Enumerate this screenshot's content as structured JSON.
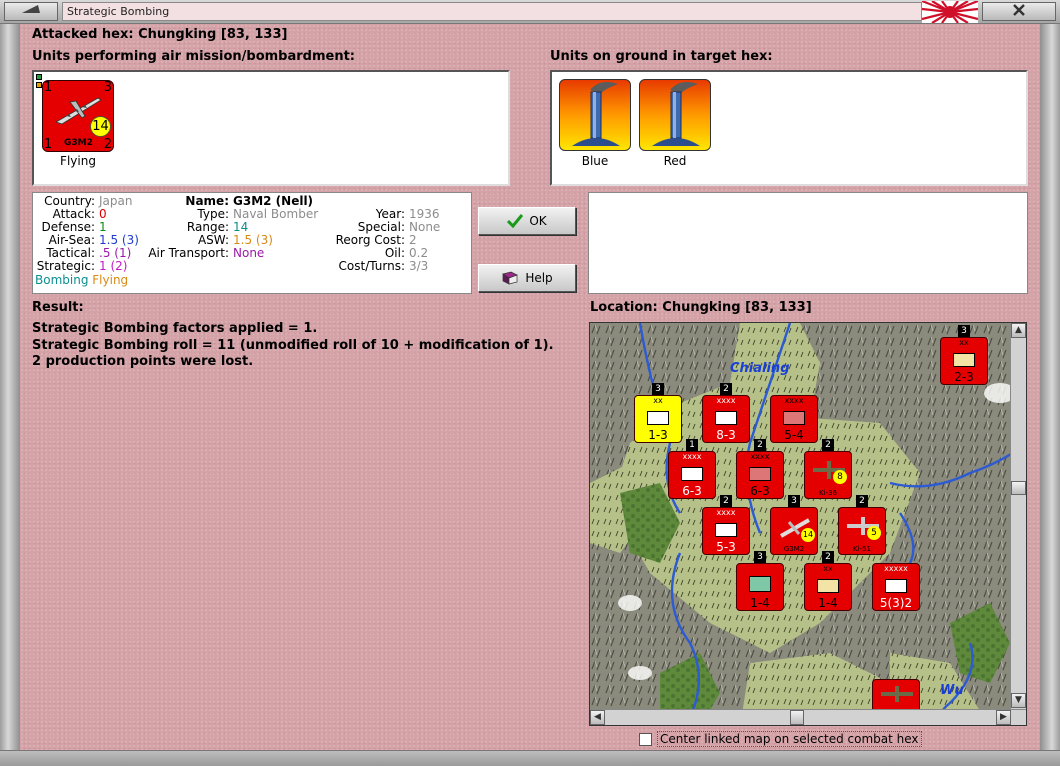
{
  "window": {
    "title": "Strategic Bombing",
    "colors": {
      "background": "#d4a2a7",
      "unit_red": "#e40000",
      "unit_yellow": "#ffff00"
    }
  },
  "attacked_hex": "Attacked hex: Chungking  [83, 133]",
  "air_units_header": "Units performing air mission/bombardment:",
  "ground_units_header": "Units on ground in target hex:",
  "air_units": [
    {
      "label": "Flying",
      "designation": "G3M2",
      "corner_tl": "1",
      "corner_tr": "3",
      "corner_bl": "1",
      "corner_br": "2",
      "range": "14"
    }
  ],
  "ground_units": [
    {
      "label": "Blue"
    },
    {
      "label": "Red"
    }
  ],
  "unit_stats": {
    "country_label": "Country:",
    "country_value": "Japan",
    "attack_label": "Attack:",
    "attack_value": "0",
    "defense_label": "Defense:",
    "defense_value": "1",
    "air_sea_label": "Air-Sea:",
    "air_sea_value": "1.5",
    "air_sea_paren": "(3)",
    "tactical_label": "Tactical:",
    "tactical_value": ".5",
    "tactical_paren": "(1)",
    "strategic_label": "Strategic:",
    "strategic_value": "1",
    "strategic_paren": "(2)",
    "mission_bombing": "Bombing",
    "mission_flying": "Flying",
    "name_label": "Name:",
    "name_value": "G3M2 (Nell)",
    "type_label": "Type:",
    "type_value": "Naval Bomber",
    "range_label": "Range:",
    "range_value": "14",
    "asw_label": "ASW:",
    "asw_value": "1.5",
    "asw_paren": "(3)",
    "air_transport_label": "Air Transport:",
    "air_transport_value": "None",
    "year_label": "Year:",
    "year_value": "1936",
    "special_label": "Special:",
    "special_value": "None",
    "reorg_label": "Reorg Cost:",
    "reorg_value": "2",
    "oil_label": "Oil:",
    "oil_value": "0.2",
    "cost_label": "Cost/Turns:",
    "cost_value": "3/3"
  },
  "buttons": {
    "ok": "OK",
    "help": "Help"
  },
  "result_header": "Result:",
  "result_lines": [
    "Strategic Bombing factors applied = 1.",
    "Strategic Bombing roll = 11 (unmodified roll of 10 + modification of 1).",
    "2 production points were lost."
  ],
  "location": "Location:  Chungking  [83, 133]",
  "map_labels": {
    "city1": "Chialing",
    "river": "Wu"
  },
  "map_units": [
    {
      "top": "xx",
      "value": "1-3",
      "badge": "3",
      "color": "#ffff00",
      "side": ""
    },
    {
      "top": "xxxx",
      "value": "8-3",
      "badge": "2",
      "color": "#e40000",
      "side": "R"
    },
    {
      "top": "xxxx",
      "value": "5-4",
      "badge": "",
      "color": "#e40000",
      "side": ""
    },
    {
      "top": "xxxx",
      "value": "6-3",
      "badge": "1",
      "color": "#e40000",
      "side": "R"
    },
    {
      "top": "xxxx",
      "value": "6-3",
      "badge": "2",
      "color": "#e40000",
      "side": ""
    },
    {
      "top": "",
      "value": "Ki-36",
      "badge": "2",
      "color": "#e40000",
      "side": "8"
    },
    {
      "top": "xxxx",
      "value": "5-3",
      "badge": "2",
      "color": "#e40000",
      "side": ""
    },
    {
      "top": "",
      "value": "G3M2",
      "badge": "3",
      "color": "#e40000",
      "side": "14"
    },
    {
      "top": "",
      "value": "Ki-51",
      "badge": "2",
      "color": "#e40000",
      "side": "5"
    },
    {
      "top": "",
      "value": "1-4",
      "badge": "3",
      "color": "#e40000",
      "side": ""
    },
    {
      "top": "xx",
      "value": "1-4",
      "badge": "2",
      "color": "#e40000",
      "side": ""
    },
    {
      "top": "xxxxx",
      "value": "5(3)2",
      "badge": "",
      "color": "#e40000",
      "side": ""
    },
    {
      "top": "xx",
      "value": "2-3",
      "badge": "3",
      "color": "#e40000",
      "side": ""
    }
  ],
  "center_checkbox": "Center linked map on selected combat hex"
}
